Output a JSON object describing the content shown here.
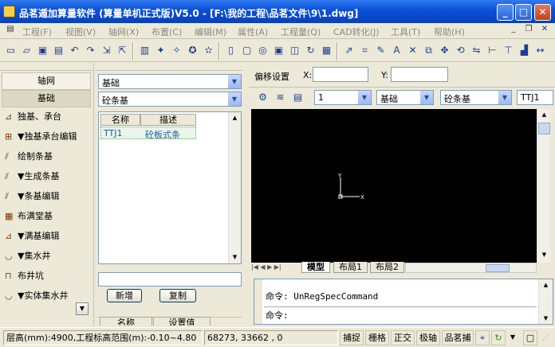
{
  "window": {
    "title": "品茗遁加算量软件 (算量单机正式版)V5.0 - [F:\\我的工程\\品茗文件\\9\\1.dwg]"
  },
  "menu": [
    "工程(F)",
    "视图(V)",
    "轴网(X)",
    "布置(C)",
    "编辑(M)",
    "属性(A)",
    "工程量(Q)",
    "CAD转化(J)",
    "工具(T)",
    "帮助(H)"
  ],
  "left_panel": {
    "tab_axis": "轴网",
    "tab_foundation": "基础",
    "items": [
      "独基、承台",
      "▼独基承台编辑",
      "绘制条基",
      "▼生成条基",
      "▼条基编辑",
      "布满堂基",
      "▼满基编辑",
      "▼集水井",
      "布井坑",
      "▼实体集水井"
    ]
  },
  "middle_panel": {
    "combo_category": "基础",
    "combo_type": "砼条基",
    "table_headers": [
      "名称",
      "描述"
    ],
    "rows": [
      {
        "name": "TTJ1",
        "desc": "砼板式条"
      }
    ],
    "btn_add": "新增",
    "btn_copy": "复制",
    "bottom_headers": [
      "名称",
      "设置值"
    ]
  },
  "offset": {
    "label": "偏移设置",
    "x_label": "X:",
    "y_label": "Y:",
    "x_value": "",
    "y_value": ""
  },
  "draw_toolbar": {
    "floor": "1",
    "category": "基础",
    "type": "砼条基",
    "member": "TTJ1"
  },
  "canvas": {
    "axis_y": "Y",
    "axis_x": "X"
  },
  "tabs": [
    "模型",
    "布局1",
    "布局2"
  ],
  "command": {
    "line1": "命令: UnRegSpecCommand",
    "line2": "命令:"
  },
  "status": {
    "elevation": "层高(mm):4900,工程标高范围(m):-0.10~4.80",
    "coords": "68273,    33662  , 0",
    "buttons": [
      "捕捉",
      "栅格",
      "正交",
      "极轴",
      "品茗捕"
    ]
  }
}
